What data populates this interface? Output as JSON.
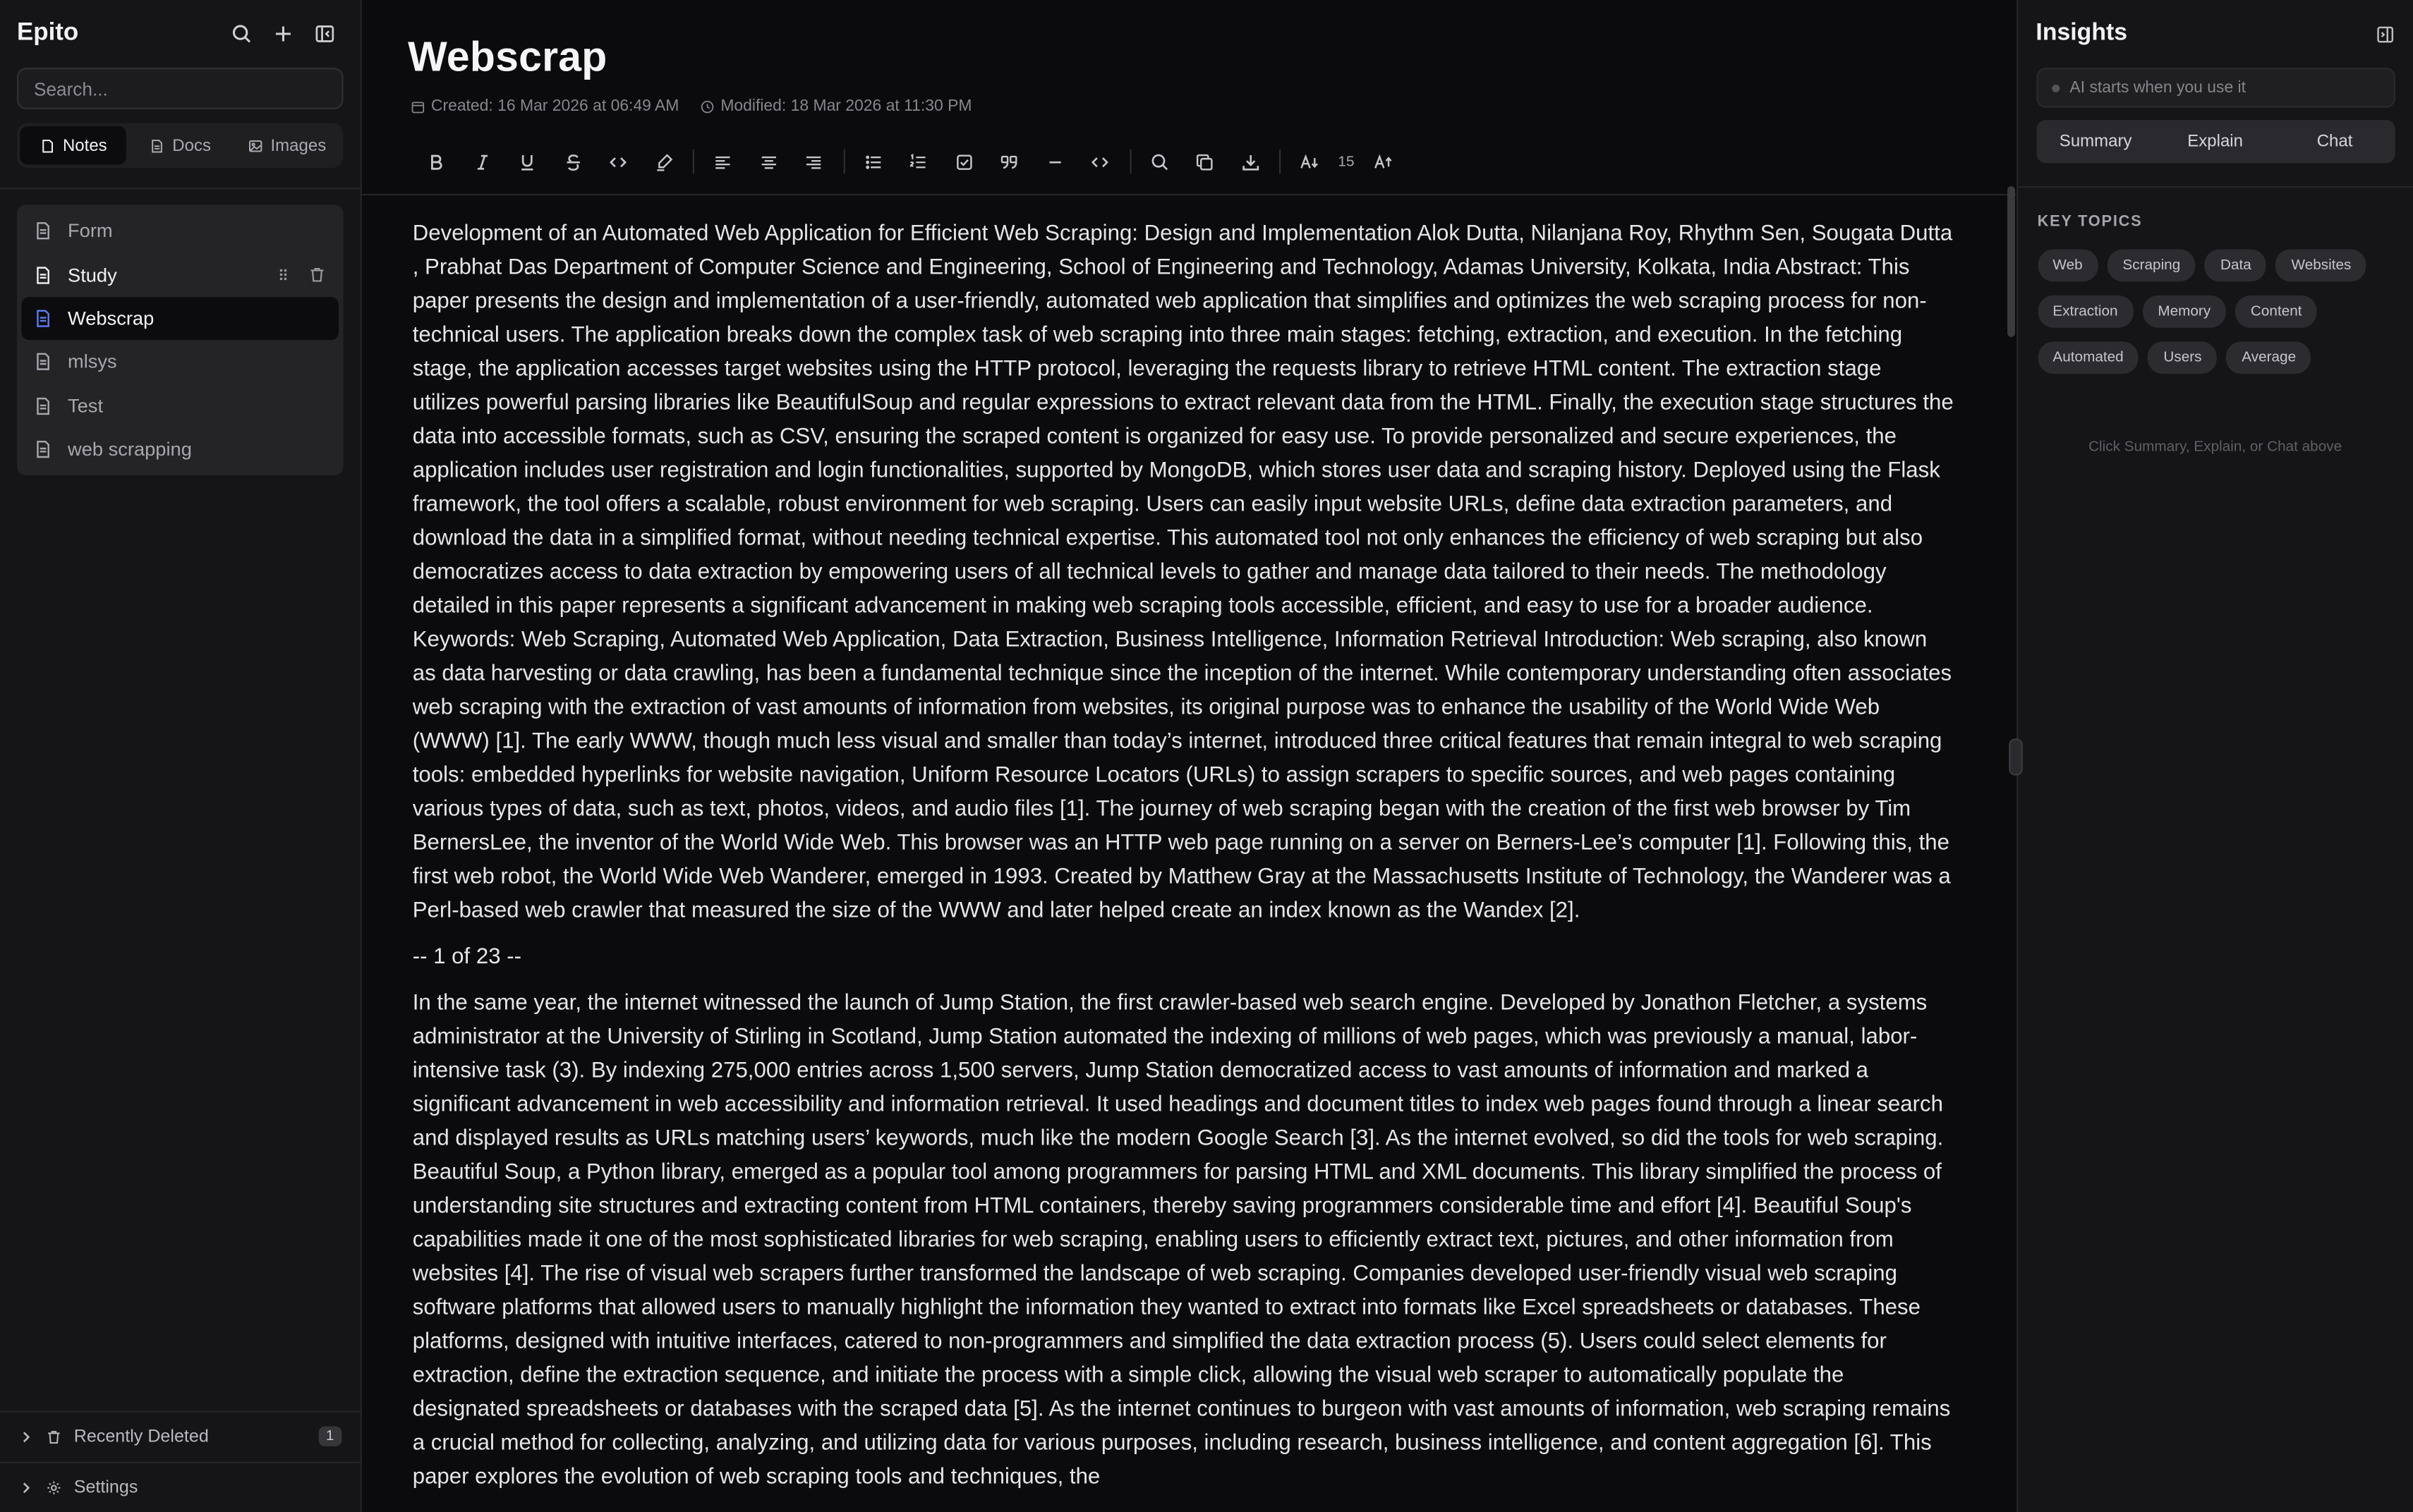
{
  "sidebar": {
    "brand": "Epito",
    "search_placeholder": "Search...",
    "tabs": [
      {
        "label": "Notes",
        "icon": "note-icon",
        "active": true
      },
      {
        "label": "Docs",
        "icon": "document-icon",
        "active": false
      },
      {
        "label": "Images",
        "icon": "image-icon",
        "active": false
      }
    ],
    "notes": [
      {
        "label": "Form"
      },
      {
        "label": "Study"
      },
      {
        "label": "Webscrap"
      },
      {
        "label": "mlsys"
      },
      {
        "label": "Test"
      },
      {
        "label": "web scrapping"
      }
    ],
    "recently_deleted": {
      "label": "Recently Deleted",
      "count": "1"
    },
    "settings": {
      "label": "Settings"
    }
  },
  "document": {
    "title": "Webscrap",
    "created": "Created: 16 Mar 2026 at 06:49 AM",
    "modified": "Modified: 18 Mar 2026 at 11:30 PM",
    "font_size": "15",
    "paragraphs": [
      "Development of an Automated Web Application for Efficient Web Scraping: Design and Implementation Alok Dutta, Nilanjana Roy, Rhythm Sen, Sougata Dutta , Prabhat Das Department of Computer Science and Engineering, School of Engineering and Technology, Adamas University, Kolkata, India Abstract: This paper presents the design and implementation of a user-friendly, automated web application that simplifies and optimizes the web scraping process for non-technical users. The application breaks down the complex task of web scraping into three main stages: fetching, extraction, and execution. In the fetching stage, the application accesses target websites using the HTTP protocol, leveraging the requests library to retrieve HTML content. The extraction stage utilizes powerful parsing libraries like BeautifulSoup and regular expressions to extract relevant data from the HTML. Finally, the execution stage structures the data into accessible formats, such as CSV, ensuring the scraped content is organized for easy use. To provide personalized and secure experiences, the application includes user registration and login functionalities, supported by MongoDB, which stores user data and scraping history. Deployed using the Flask framework, the tool offers a scalable, robust environment for web scraping. Users can easily input website URLs, define data extraction parameters, and download the data in a simplified format, without needing technical expertise. This automated tool not only enhances the efficiency of web scraping but also democratizes access to data extraction by empowering users of all technical levels to gather and manage data tailored to their needs. The methodology detailed in this paper represents a significant advancement in making web scraping tools accessible, efficient, and easy to use for a broader audience. Keywords: Web Scraping, Automated Web Application, Data Extraction, Business Intelligence, Information Retrieval Introduction: Web scraping, also known as data harvesting or data crawling, has been a fundamental technique since the inception of the internet. While contemporary understanding often associates web scraping with the extraction of vast amounts of information from websites, its original purpose was to enhance the usability of the World Wide Web (WWW) [1]. The early WWW, though much less visual and smaller than today’s internet, introduced three critical features that remain integral to web scraping tools: embedded hyperlinks for website navigation, Uniform Resource Locators (URLs) to assign scrapers to specific sources, and web pages containing various types of data, such as text, photos, videos, and audio files [1]. The journey of web scraping began with the creation of the first web browser by Tim BernersLee, the inventor of the World Wide Web. This browser was an HTTP web page running on a server on Berners-Lee’s computer [1]. Following this, the first web robot, the World Wide Web Wanderer, emerged in 1993. Created by Matthew Gray at the Massachusetts Institute of Technology, the Wanderer was a Perl-based web crawler that measured the size of the WWW and later helped create an index known as the Wandex [2].",
      "-- 1 of 23 --",
      "In the same year, the internet witnessed the launch of Jump Station, the first crawler-based web search engine. Developed by Jonathon Fletcher, a systems administrator at the University of Stirling in Scotland, Jump Station automated the indexing of millions of web pages, which was previously a manual, labor-intensive task (3). By indexing 275,000 entries across 1,500 servers, Jump Station democratized access to vast amounts of information and marked a significant advancement in web accessibility and information retrieval. It used headings and document titles to index web pages found through a linear search and displayed results as URLs matching users’ keywords, much like the modern Google Search [3]. As the internet evolved, so did the tools for web scraping. Beautiful Soup, a Python library, emerged as a popular tool among programmers for parsing HTML and XML documents. This library simplified the process of understanding site structures and extracting content from HTML containers, thereby saving programmers considerable time and effort [4]. Beautiful Soup's capabilities made it one of the most sophisticated libraries for web scraping, enabling users to efficiently extract text, pictures, and other information from websites [4]. The rise of visual web scrapers further transformed the landscape of web scraping. Companies developed user-friendly visual web scraping software platforms that allowed users to manually highlight the information they wanted to extract into formats like Excel spreadsheets or databases. These platforms, designed with intuitive interfaces, catered to non-programmers and simplified the data extraction process (5). Users could select elements for extraction, define the extraction sequence, and initiate the process with a simple click, allowing the visual web scraper to automatically populate the designated spreadsheets or databases with the scraped data [5]. As the internet continues to burgeon with vast amounts of information, web scraping remains a crucial method for collecting, analyzing, and utilizing data for various purposes, including research, business intelligence, and content aggregation [6]. This paper explores the evolution of web scraping tools and techniques, the"
    ]
  },
  "insights": {
    "title": "Insights",
    "ai_status": "AI starts when you use it",
    "tabs": [
      "Summary",
      "Explain",
      "Chat"
    ],
    "key_topics_label": "KEY TOPICS",
    "topics": [
      "Web",
      "Scraping",
      "Data",
      "Websites",
      "Extraction",
      "Memory",
      "Content",
      "Automated",
      "Users",
      "Average"
    ],
    "hint": "Click Summary, Explain, or Chat above"
  },
  "colors": {
    "background": "#0b0b0d",
    "panel": "#151517",
    "accent": "#5b7cf6"
  }
}
